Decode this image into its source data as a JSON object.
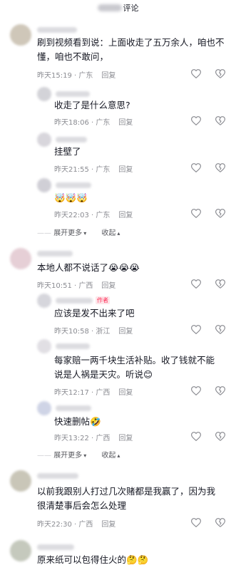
{
  "header": {
    "title": "评论"
  },
  "icons": {
    "like": "heart-outline-icon",
    "dislike": "broken-heart-icon",
    "chevron": "chevron-down-icon"
  },
  "comments": [
    {
      "text": "刷到视频看到说：上面收走了五万余人，咱也不懂，咱也不敢问，",
      "meta": "昨天15:19 · 广东",
      "reply": "回复",
      "replies": [
        {
          "text": "收走了是什么意思?",
          "meta": "昨天18:06 · 广东",
          "reply": "回复"
        },
        {
          "text": "挂壁了",
          "meta": "昨天21:55 · 广东",
          "reply": "回复"
        },
        {
          "text": "🤯🤯🤯",
          "meta": "昨天22:03 · 广东",
          "reply": "回复"
        }
      ],
      "expand": "展开更多",
      "collapse": "收起"
    },
    {
      "text": "本地人都不说话了😭😭😭",
      "meta": "昨天10:51 · 广西",
      "reply": "回复",
      "replies": [
        {
          "author_tag": "作者",
          "text": "应该是发不出来了吧",
          "meta": "昨天10:58 · 浙江",
          "reply": "回复"
        },
        {
          "text": "每家赔一两千块生活补贴。收了钱就不能说是人祸是天灾。听说😊",
          "meta": "昨天12:17 · 广西",
          "reply": "回复"
        },
        {
          "text": "快速删帖🤣",
          "meta": "昨天13:22 · 广西",
          "reply": "回复"
        }
      ],
      "expand": "展开更多",
      "collapse": "收起"
    },
    {
      "text": "以前我跟别人打过几次赌都是我赢了，因为我很清楚事后会怎么处理",
      "meta": "昨天22:30 · 广西",
      "reply": "回复"
    },
    {
      "text": "原来纸可以包得住火的🤔🤔"
    }
  ]
}
